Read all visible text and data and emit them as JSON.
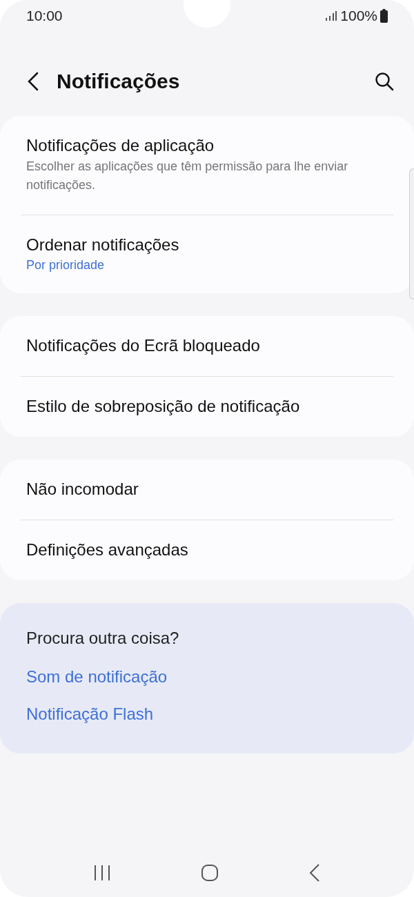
{
  "status_bar": {
    "time": "10:00",
    "battery": "100%"
  },
  "header": {
    "title": "Notificações"
  },
  "groups": [
    {
      "items": [
        {
          "title": "Notificações de aplicação",
          "description": "Escolher as aplicações que têm permissão para lhe enviar notificações."
        },
        {
          "title": "Ordenar notificações",
          "value": "Por prioridade"
        }
      ]
    },
    {
      "items": [
        {
          "title": "Notificações do Ecrã bloqueado"
        },
        {
          "title": "Estilo de sobreposição de notificação"
        }
      ]
    },
    {
      "items": [
        {
          "title": "Não incomodar"
        },
        {
          "title": "Definições avançadas"
        }
      ]
    }
  ],
  "suggestions": {
    "title": "Procura outra coisa?",
    "links": [
      "Som de notificação",
      "Notificação Flash"
    ]
  }
}
